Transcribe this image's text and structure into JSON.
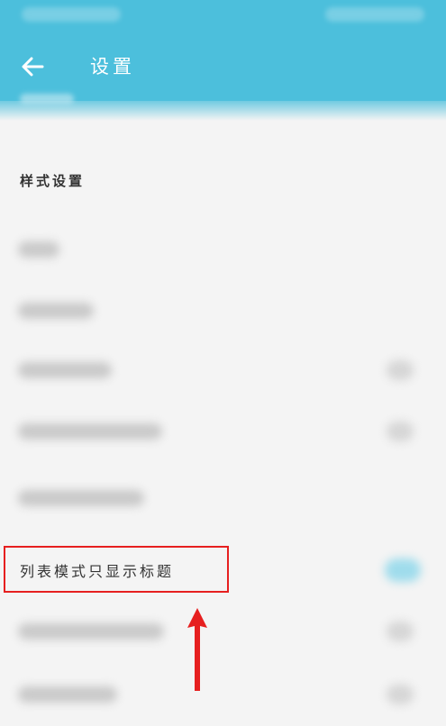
{
  "header": {
    "title": "设置",
    "back_icon": "arrow-left-icon",
    "background_color": "#4cbfdc"
  },
  "sections": [
    {
      "title": "样式设置",
      "items": [
        {
          "label": "列表模式只显示标题",
          "highlighted": true
        }
      ]
    }
  ],
  "annotation": {
    "box_color": "#e61f1f",
    "arrow_color": "#e61f1f",
    "arrow_icon": "arrow-up-icon"
  }
}
